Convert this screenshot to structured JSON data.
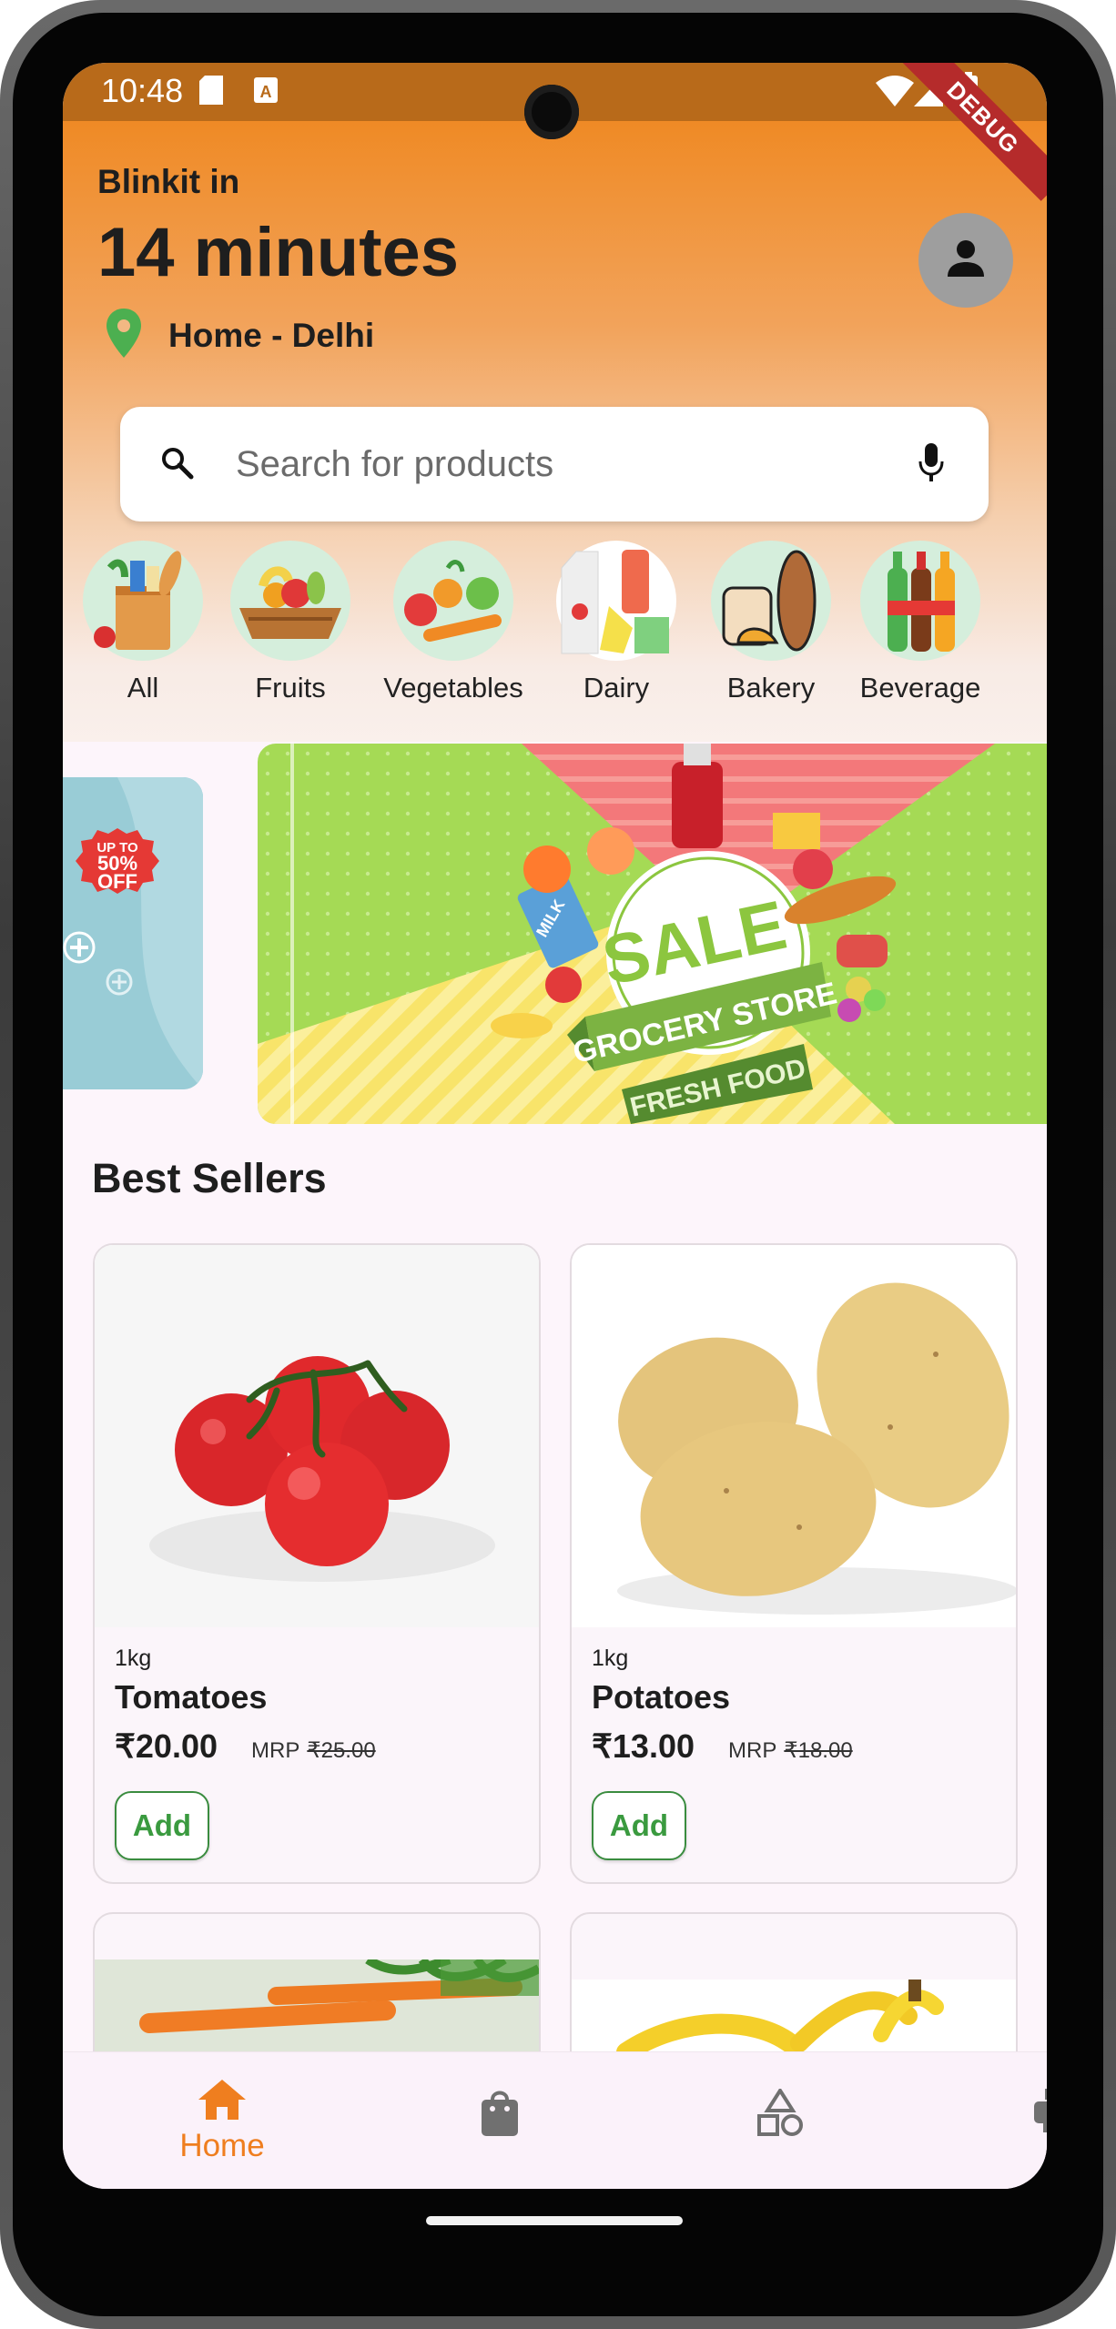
{
  "status_bar": {
    "time": "10:48",
    "debug_label": "DEBUG"
  },
  "header": {
    "brand_line": "Blinkit in",
    "eta": "14 minutes",
    "location": "Home - Delhi"
  },
  "search": {
    "placeholder": "Search for products"
  },
  "categories": [
    {
      "label": "All",
      "icon": "grocery-bag-icon"
    },
    {
      "label": "Fruits",
      "icon": "fruit-basket-icon"
    },
    {
      "label": "Vegetables",
      "icon": "vegetables-icon"
    },
    {
      "label": "Dairy",
      "icon": "dairy-icon"
    },
    {
      "label": "Bakery",
      "icon": "bread-icon"
    },
    {
      "label": "Beverage",
      "icon": "bottles-icon"
    }
  ],
  "banners": {
    "left_badge_line1": "UP TO",
    "left_badge_line2": "50%",
    "left_badge_line3": "OFF",
    "main_line1": "SALE",
    "main_line2": "GROCERY STORE",
    "main_line3": "FRESH FOOD",
    "milk_label": "MILK"
  },
  "best_sellers": {
    "title": "Best Sellers",
    "products": [
      {
        "weight": "1kg",
        "name": "Tomatoes",
        "price": "₹20.00",
        "mrp_label": "MRP",
        "mrp": "₹25.00",
        "add_label": "Add"
      },
      {
        "weight": "1kg",
        "name": "Potatoes",
        "price": "₹13.00",
        "mrp_label": "MRP",
        "mrp": "₹18.00",
        "add_label": "Add"
      }
    ]
  },
  "bottom_nav": {
    "items": [
      {
        "label": "Home",
        "icon": "home-icon",
        "active": true
      },
      {
        "label": "",
        "icon": "shopping-bag-icon",
        "active": false
      },
      {
        "label": "",
        "icon": "categories-shapes-icon",
        "active": false
      },
      {
        "label": "",
        "icon": "printer-icon",
        "active": false
      }
    ]
  },
  "colors": {
    "accent_orange": "#ef7e1f",
    "add_green": "#3a9a3f",
    "header_top": "#ef8a25",
    "location_pin_green": "#4caf50"
  }
}
